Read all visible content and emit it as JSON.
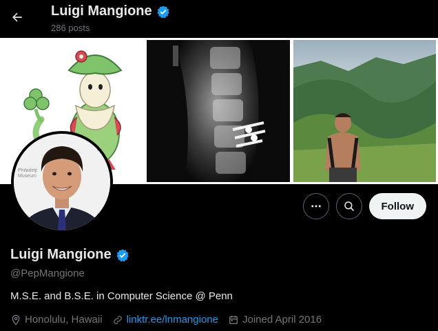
{
  "header": {
    "name": "Luigi Mangione",
    "posts_count": "286 posts",
    "back_icon": "arrow-left-icon",
    "verified_icon": "verified-badge-icon"
  },
  "banner": {
    "panels": [
      "pokemon-illustration",
      "spine-xray",
      "hiking-photo"
    ],
    "avatar_sign_text": "Philadelphia Museum"
  },
  "actions": {
    "more_icon": "more-dots-icon",
    "search_icon": "search-icon",
    "follow_label": "Follow"
  },
  "profile": {
    "name": "Luigi Mangione",
    "handle": "@PepMangione",
    "bio": "M.S.E. and B.S.E. in Computer Science @ Penn",
    "location": "Honolulu, Hawaii",
    "website": "linktr.ee/lnmangione",
    "joined": "Joined April 2016"
  },
  "colors": {
    "background": "#000000",
    "text": "#e7e9ea",
    "muted": "#71767b",
    "accent": "#1d9bf0",
    "follow_bg": "#eff3f4"
  }
}
